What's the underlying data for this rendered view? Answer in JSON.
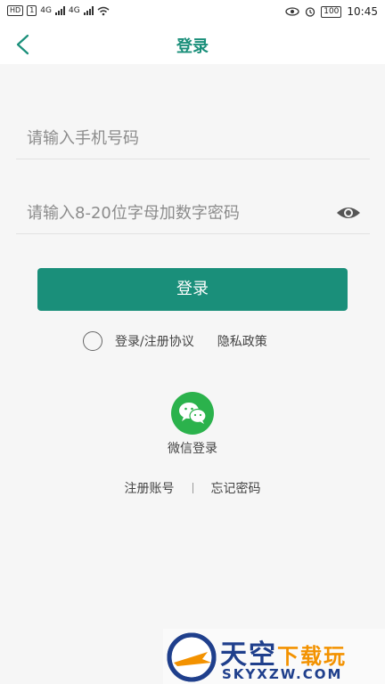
{
  "status_bar": {
    "left_chip_hd": "HD",
    "left_chip_sim": "1",
    "net_1": "4G",
    "net_2": "4G",
    "battery": "100",
    "time": "10:45"
  },
  "header": {
    "title": "登录"
  },
  "form": {
    "phone_placeholder": "请输入手机号码",
    "password_placeholder": "请输入8-20位字母加数字密码",
    "login_button": "登录"
  },
  "agreement": {
    "terms_label": "登录/注册协议",
    "privacy_label": "隐私政策"
  },
  "social": {
    "wechat_label": "微信登录"
  },
  "footer_links": {
    "register": "注册账号",
    "divider": "|",
    "forgot_password": "忘记密码"
  },
  "watermark": {
    "title_main": "天空",
    "title_accent": "下载玩",
    "domain": "SKYXZW.COM"
  },
  "colors": {
    "accent": "#1a8f7a",
    "wechat": "#2bb24c",
    "background": "#f6f6f6"
  }
}
